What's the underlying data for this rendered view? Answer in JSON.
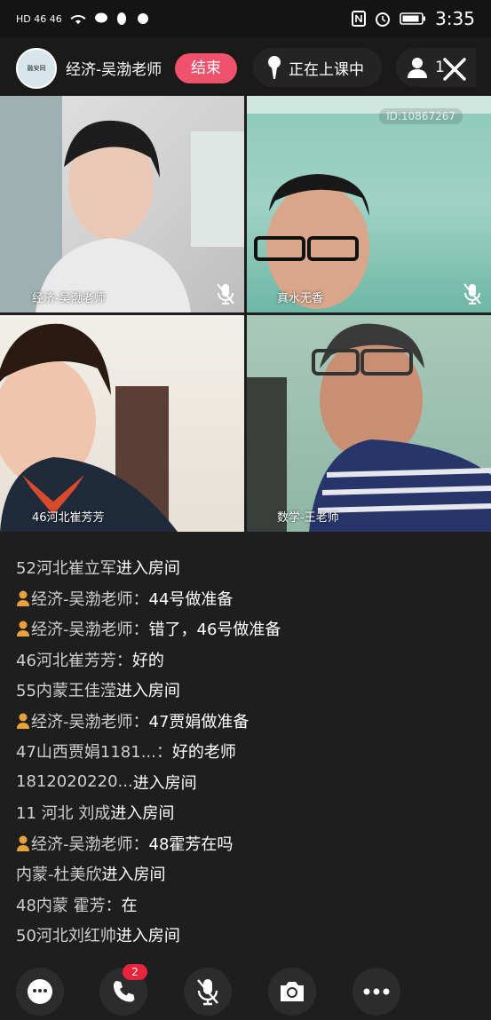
{
  "statusbar": {
    "left_text": "HD 46 46",
    "time": "3:35"
  },
  "header": {
    "avatar_text": "融安同",
    "teacher_name": "经济-吴渤老师",
    "end_label": "结束",
    "class_status": "正在上课中",
    "viewer_count": "1"
  },
  "videos": [
    {
      "label": "经济-吴渤老师"
    },
    {
      "label": "真水无香",
      "id_badge": "ID:10867267"
    },
    {
      "label": "46河北崔芳芳"
    },
    {
      "label": "数学-王老师"
    }
  ],
  "chat": [
    {
      "user": "52河北崔立军",
      "text": " 进入房间",
      "teacher": false,
      "join": true
    },
    {
      "user": "经济-吴渤老师：",
      "text": "44号做准备",
      "teacher": true,
      "join": false
    },
    {
      "user": "经济-吴渤老师：",
      "text": "错了，46号做准备",
      "teacher": true,
      "join": false
    },
    {
      "user": "46河北崔芳芳：",
      "text": "好的",
      "teacher": false,
      "join": false
    },
    {
      "user": "55内蒙王佳滢",
      "text": " 进入房间",
      "teacher": false,
      "join": true
    },
    {
      "user": "经济-吴渤老师：",
      "text": "47贾娟做准备",
      "teacher": true,
      "join": false
    },
    {
      "user": "47山西贾娟1181...：",
      "text": "好的老师",
      "teacher": false,
      "join": false
    },
    {
      "user": "1812020220...",
      "text": " 进入房间",
      "teacher": false,
      "join": true
    },
    {
      "user": "11 河北 刘成",
      "text": " 进入房间",
      "teacher": false,
      "join": true
    },
    {
      "user": "经济-吴渤老师：",
      "text": "48霍芳在吗",
      "teacher": true,
      "join": false
    },
    {
      "user": "内蒙-杜美欣",
      "text": " 进入房间",
      "teacher": false,
      "join": true
    },
    {
      "user": "48内蒙 霍芳：",
      "text": "在",
      "teacher": false,
      "join": false
    },
    {
      "user": "50河北刘红帅",
      "text": " 进入房间",
      "teacher": false,
      "join": true
    }
  ],
  "bottom": {
    "phone_badge": "2"
  },
  "colors": {
    "accent": "#f0516b",
    "badge": "#e8253d",
    "teacher_icon": "#e8a23c"
  }
}
